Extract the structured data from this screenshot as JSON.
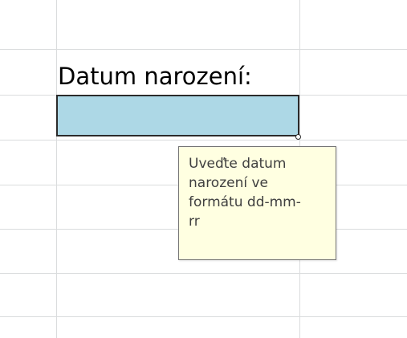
{
  "sheet": {
    "label": "Datum narození:",
    "input_value": "",
    "input_fill_color": "#add8e6",
    "gridline_color": "#dadcdd"
  },
  "tooltip": {
    "lines": [
      "Uveďte datum",
      "narození ve",
      "formátu dd-mm-",
      "rr"
    ],
    "background_color": "#ffffe1"
  }
}
